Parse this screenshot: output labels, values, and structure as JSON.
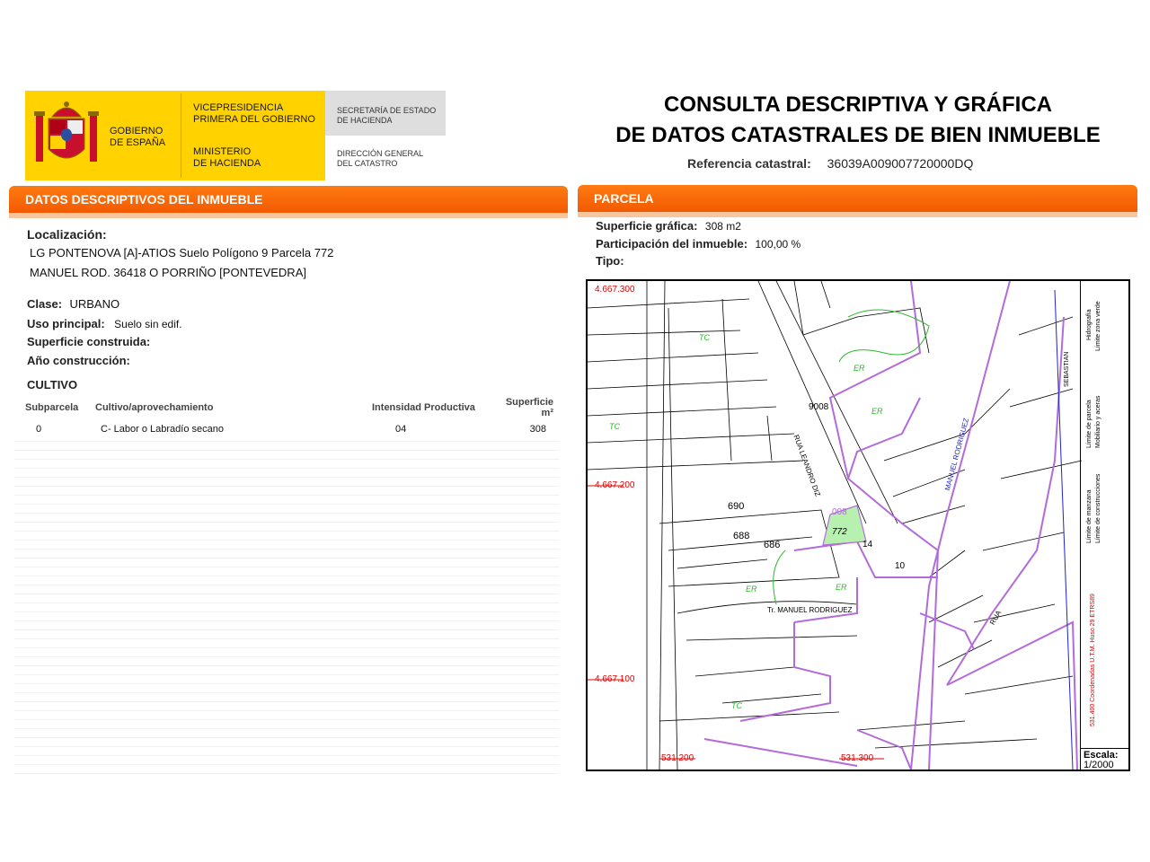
{
  "header": {
    "gov_name": [
      "GOBIERNO",
      "DE ESPAÑA"
    ],
    "vicepresidencia": [
      "VICEPRESIDENCIA",
      "PRIMERA DEL GOBIERNO"
    ],
    "ministerio": [
      "MINISTERIO",
      "DE HACIENDA"
    ],
    "secretaria": [
      "SECRETARÍA DE ESTADO",
      "DE HACIENDA"
    ],
    "direccion": [
      "DIRECCIÓN GENERAL",
      "DEL CATASTRO"
    ],
    "title_line1": "CONSULTA DESCRIPTIVA Y GRÁFICA",
    "title_line2": "DE DATOS CATASTRALES DE BIEN INMUEBLE",
    "ref_label": "Referencia catastral:",
    "ref_value": "36039A009007720000DQ"
  },
  "datos": {
    "section_title": "DATOS DESCRIPTIVOS DEL INMUEBLE",
    "localizacion_label": "Localización:",
    "localizacion_line1": "LG PONTENOVA [A]-ATIOS  Suelo Polígono 9 Parcela 772",
    "localizacion_line2": "MANUEL ROD. 36418 O PORRIÑO [PONTEVEDRA]",
    "clase_label": "Clase:",
    "clase_value": "URBANO",
    "uso_label": "Uso principal:",
    "uso_value": "Suelo sin edif.",
    "sup_construida_label": "Superficie construida:",
    "anio_label": "Año construcción:"
  },
  "cultivo": {
    "title": "CULTIVO",
    "columns": [
      "Subparcela",
      "Cultivo/aprovechamiento",
      "Intensidad Productiva",
      "Superficie m²"
    ],
    "rows": [
      [
        "0",
        "C- Labor o Labradío secano",
        "04",
        "308"
      ]
    ]
  },
  "parcela": {
    "section_title": "PARCELA",
    "sup_grafica_label": "Superficie gráfica:",
    "sup_grafica_value": "308 m2",
    "participacion_label": "Participación del inmueble:",
    "participacion_value": "100,00 %",
    "tipo_label": "Tipo:"
  },
  "map": {
    "coords": [
      "4.667.300",
      "4.667.200",
      "4.667.100",
      "531.200",
      "531.300"
    ],
    "parcel_labels": [
      "690",
      "688",
      "686",
      "772",
      "14",
      "10",
      "9008",
      "008"
    ],
    "zone_labels": [
      "TC",
      "ER"
    ],
    "street_labels": [
      "RUA LEANDRO DIZ",
      "MANUEL RODRIGUEZ",
      "Tr. MANUEL RODRIGUEZ",
      "RUA",
      "SEBASTIAN"
    ],
    "legend": [
      "Hidrografía",
      "Límite zona verde",
      "Límite de parcela",
      "Mobiliario y aceras",
      "Límite de manzana",
      "Límite de construcciones"
    ],
    "coord_note": "531.400 Coordenadas U.T.M. Huso 29 ETRS89",
    "escala_label": "Escala:",
    "escala_value": "1/2000"
  },
  "colors": {
    "orange": "#f25a00",
    "yellow": "#ffd200",
    "purple": "#b36bd9",
    "green": "#2eb82e",
    "blue": "#2222cc",
    "red": "#e00000"
  }
}
